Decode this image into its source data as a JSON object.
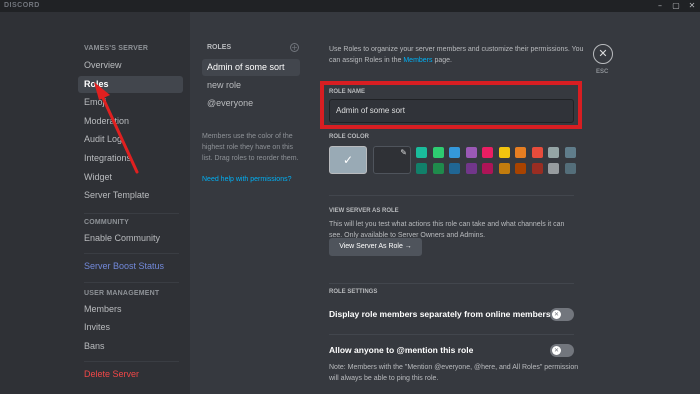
{
  "titlebar": {
    "app_name": "DISCORD",
    "minimize": "–",
    "maximize": "▢",
    "close": "✕"
  },
  "sidebar": {
    "server_name": "VAMES'S SERVER",
    "items": [
      {
        "label": "Overview"
      },
      {
        "label": "Roles"
      },
      {
        "label": "Emoji"
      },
      {
        "label": "Moderation"
      },
      {
        "label": "Audit Log"
      },
      {
        "label": "Integrations"
      },
      {
        "label": "Widget"
      },
      {
        "label": "Server Template"
      }
    ],
    "community_header": "COMMUNITY",
    "enable_community": "Enable Community",
    "boost_status": "Server Boost Status",
    "user_mgmt_header": "USER MANAGEMENT",
    "members": "Members",
    "invites": "Invites",
    "bans": "Bans",
    "delete_server": "Delete Server"
  },
  "roles_column": {
    "header": "ROLES",
    "add_icon": "+",
    "roles": [
      {
        "label": "Admin of some sort"
      },
      {
        "label": "new role"
      },
      {
        "label": "@everyone"
      }
    ],
    "description": "Members use the color of the highest role they have on this list. Drag roles to reorder them.",
    "help_link": "Need help with permissions?"
  },
  "settings": {
    "intro_text": "Use Roles to organize your server members and customize their permissions. You can assign Roles in the",
    "intro_link": "Members",
    "intro_tail": "page.",
    "role_name_label": "ROLE NAME",
    "role_name_value": "Admin of some sort",
    "role_color_label": "ROLE COLOR",
    "default_check": "✓",
    "dropper_icon": "✎",
    "colors_row1": [
      "#1abc9c",
      "#2ecc71",
      "#3498db",
      "#9b59b6",
      "#e91e63",
      "#f1c40f",
      "#e67e22",
      "#e74c3c",
      "#95a5a6",
      "#607d8b"
    ],
    "colors_row2": [
      "#11806a",
      "#1f8b4c",
      "#206694",
      "#71368a",
      "#ad1457",
      "#c27c0e",
      "#a84300",
      "#992d22",
      "#979c9f",
      "#546e7a"
    ],
    "view_as_role_label": "VIEW SERVER AS ROLE",
    "view_as_role_text": "This will let you test what actions this role can take and what channels it can see. Only available to Server Owners and Admins.",
    "view_button": "View Server As Role →",
    "role_settings_label": "ROLE SETTINGS",
    "display_separately": "Display role members separately from online members",
    "allow_mention_prefix": "Allow anyone to ",
    "allow_mention_bold": "@mention",
    "allow_mention_suffix": " this role",
    "toggle_off": "✕",
    "note_text": "Note: Members with the \"Mention @everyone, @here, and All Roles\" permission will always be able to ping this role."
  },
  "close": {
    "icon": "✕",
    "label": "ESC"
  },
  "annotation": {
    "highlight_color": "#d81e22",
    "arrow_color": "#e02020"
  }
}
